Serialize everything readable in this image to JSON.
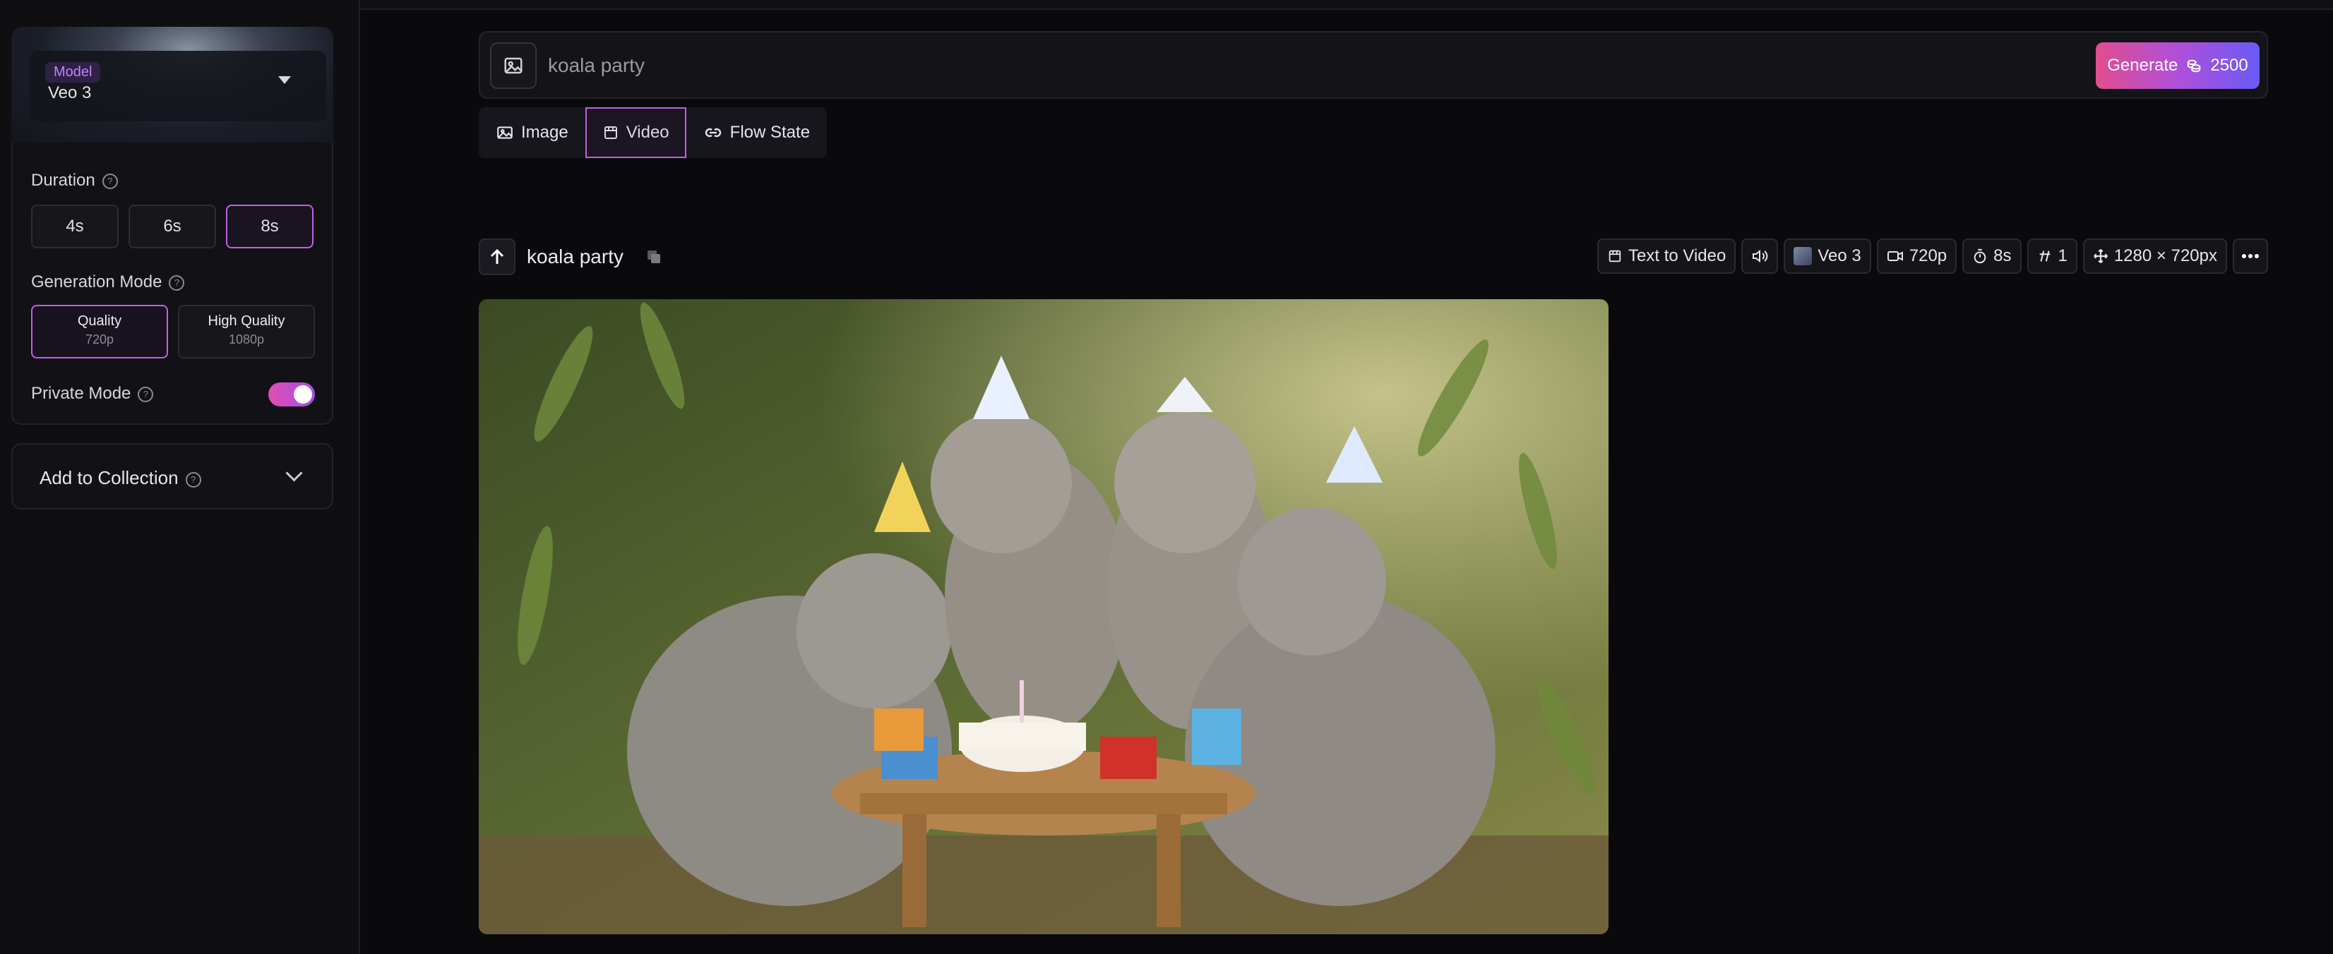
{
  "sidebar": {
    "model": {
      "tag": "Model",
      "name": "Veo 3"
    },
    "duration": {
      "label": "Duration",
      "options": [
        "4s",
        "6s",
        "8s"
      ],
      "selected": "8s"
    },
    "generation_mode": {
      "label": "Generation Mode",
      "options": [
        {
          "title": "Quality",
          "sub": "720p"
        },
        {
          "title": "High Quality",
          "sub": "1080p"
        }
      ],
      "selected": "Quality"
    },
    "private_mode": {
      "label": "Private Mode",
      "enabled": true
    },
    "collection": {
      "label": "Add to Collection"
    }
  },
  "prompt": {
    "value": "koala party",
    "placeholder": ""
  },
  "generate": {
    "label": "Generate",
    "cost": "2500"
  },
  "tabs": [
    {
      "label": "Image",
      "icon": "image-icon"
    },
    {
      "label": "Video",
      "icon": "video-icon"
    },
    {
      "label": "Flow State",
      "icon": "link-icon"
    }
  ],
  "selected_tab": "Video",
  "result": {
    "title": "koala party",
    "chips": {
      "mode": "Text to Video",
      "model": "Veo 3",
      "resolution": "720p",
      "duration": "8s",
      "count": "1",
      "size": "1280 × 720px"
    }
  },
  "colors": {
    "accent": "#c45ee8",
    "toggle_on": "#e04fb2",
    "background": "#0a0a0c"
  }
}
